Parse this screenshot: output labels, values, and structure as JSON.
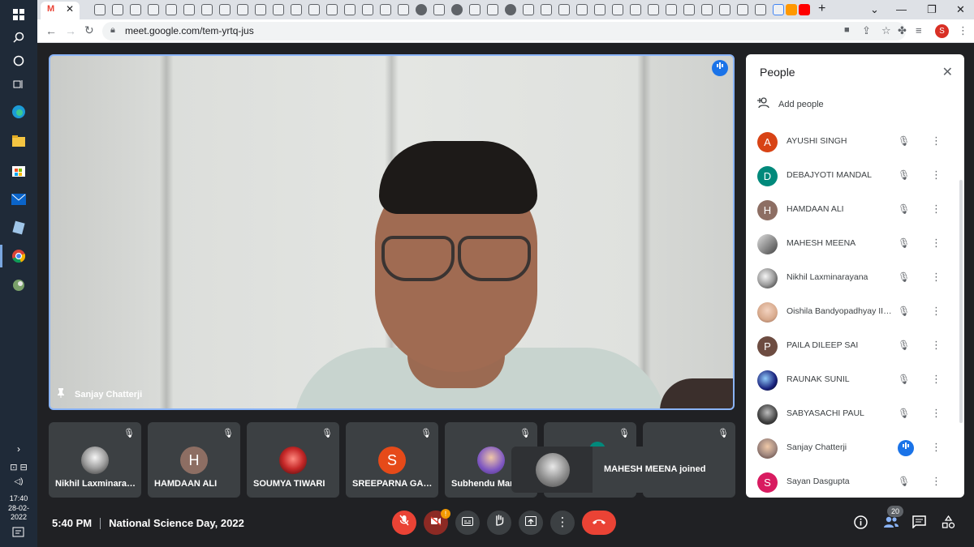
{
  "taskbar": {
    "time": "17:40",
    "date": "28-02-2022"
  },
  "browser": {
    "url": "meet.google.com/tem-yrtq-jus",
    "profile_initial": "S"
  },
  "main_video": {
    "pinned_name": "Sanjay Chatterji"
  },
  "thumbnails": [
    {
      "name": "Nikhil Laxminarayana",
      "initial": "",
      "color": "#e8e8e8"
    },
    {
      "name": "HAMDAAN ALI",
      "initial": "H",
      "color": "#8d6e63"
    },
    {
      "name": "SOUMYA TIWARI",
      "initial": "",
      "color": "#c62828"
    },
    {
      "name": "SREEPARNA GANGULY",
      "initial": "S",
      "color": "#e64a19"
    },
    {
      "name": "Subhendu Mandal",
      "initial": "",
      "color": "#7e57c2"
    },
    {
      "name": "",
      "initial": "",
      "color": "#00897b"
    },
    {
      "name": "",
      "initial": "",
      "color": "#3c4043"
    }
  ],
  "toast": {
    "text": "MAHESH MEENA joined"
  },
  "people_panel": {
    "title": "People",
    "add_label": "Add people",
    "participants": [
      {
        "name": "AYUSHI SINGH",
        "initial": "A",
        "color": "#d84315",
        "speaking": false
      },
      {
        "name": "DEBAJYOTI MANDAL",
        "initial": "D",
        "color": "#00897b",
        "speaking": false
      },
      {
        "name": "HAMDAAN ALI",
        "initial": "H",
        "color": "#8d6e63",
        "speaking": false
      },
      {
        "name": "MAHESH MEENA",
        "initial": "",
        "color": "#616161",
        "speaking": false
      },
      {
        "name": "Nikhil Laxminarayana",
        "initial": "",
        "color": "#9e9e9e",
        "speaking": false
      },
      {
        "name": "Oishila Bandyopadhyay III...",
        "initial": "",
        "color": "#d7a98c",
        "speaking": false
      },
      {
        "name": "PAILA DILEEP SAI",
        "initial": "P",
        "color": "#6d4c41",
        "speaking": false
      },
      {
        "name": "RAUNAK SUNIL",
        "initial": "",
        "color": "#1a237e",
        "speaking": false
      },
      {
        "name": "SABYASACHI PAUL",
        "initial": "",
        "color": "#424242",
        "speaking": false
      },
      {
        "name": "Sanjay Chatterji",
        "initial": "",
        "color": "#a1887f",
        "speaking": true
      },
      {
        "name": "Sayan Dasgupta",
        "initial": "S",
        "color": "#d81b60",
        "speaking": false
      }
    ]
  },
  "bottom_bar": {
    "time": "5:40 PM",
    "meeting_name": "National Science Day, 2022",
    "participant_count": "20",
    "camera_warning": "!"
  },
  "icons": {
    "mic_off": "mic-off-icon",
    "more": "more-vert-icon",
    "speaking": "speaking-icon"
  }
}
